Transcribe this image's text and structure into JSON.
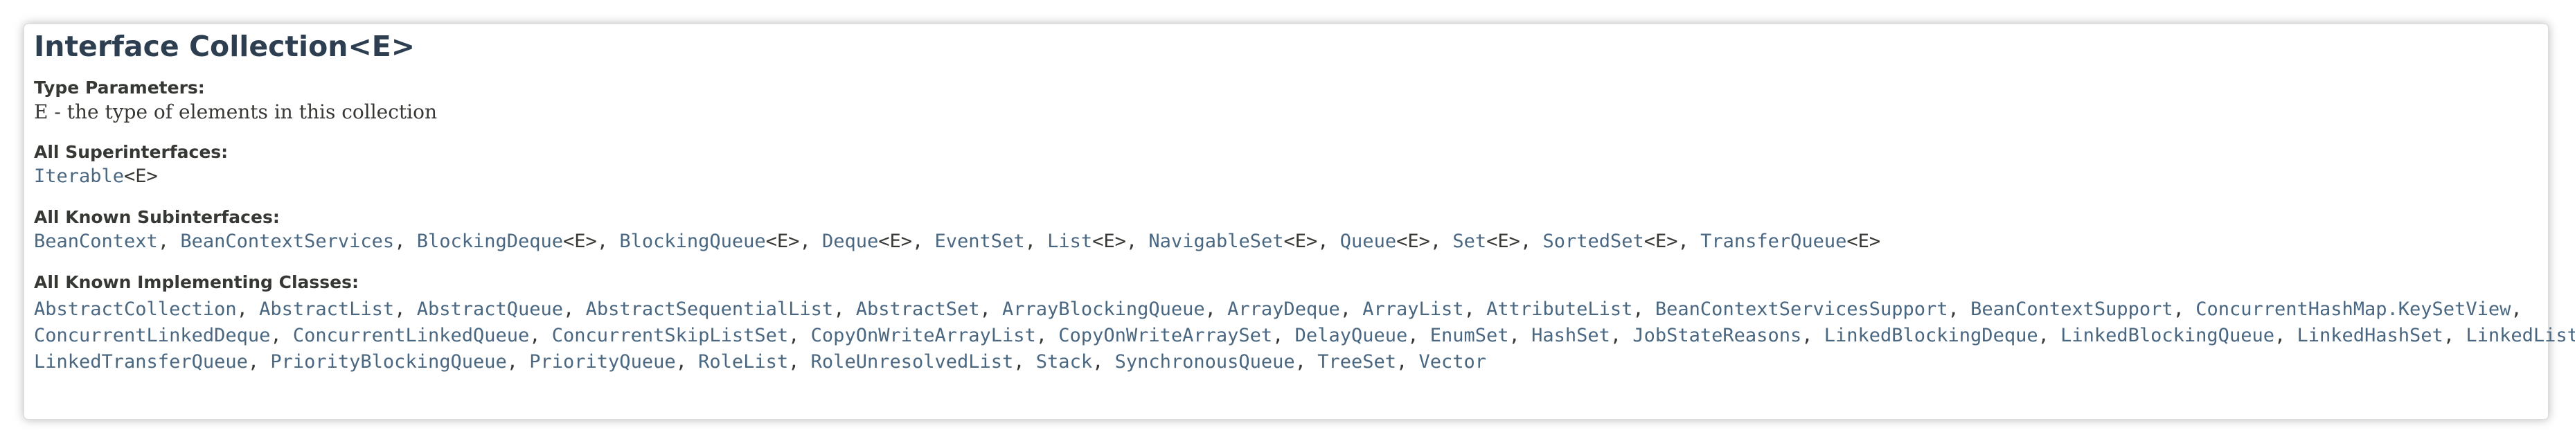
{
  "page": {
    "title": "Interface Collection<E>"
  },
  "type_parameters": {
    "label": "Type Parameters:",
    "text": "E - the type of elements in this collection"
  },
  "superinterfaces": {
    "label": "All Superinterfaces:",
    "items": [
      {
        "name": "Iterable",
        "generic": "<E>"
      }
    ]
  },
  "subinterfaces": {
    "label": "All Known Subinterfaces:",
    "items": [
      {
        "name": "BeanContext",
        "generic": ""
      },
      {
        "name": "BeanContextServices",
        "generic": ""
      },
      {
        "name": "BlockingDeque",
        "generic": "<E>"
      },
      {
        "name": "BlockingQueue",
        "generic": "<E>"
      },
      {
        "name": "Deque",
        "generic": "<E>"
      },
      {
        "name": "EventSet",
        "generic": ""
      },
      {
        "name": "List",
        "generic": "<E>"
      },
      {
        "name": "NavigableSet",
        "generic": "<E>"
      },
      {
        "name": "Queue",
        "generic": "<E>"
      },
      {
        "name": "Set",
        "generic": "<E>"
      },
      {
        "name": "SortedSet",
        "generic": "<E>"
      },
      {
        "name": "TransferQueue",
        "generic": "<E>"
      }
    ]
  },
  "implementing_classes": {
    "label": "All Known Implementing Classes:",
    "lines": [
      [
        "AbstractCollection",
        "AbstractList",
        "AbstractQueue",
        "AbstractSequentialList",
        "AbstractSet",
        "ArrayBlockingQueue",
        "ArrayDeque",
        "ArrayList",
        "AttributeList",
        "BeanContextServicesSupport",
        "BeanContextSupport",
        "ConcurrentHashMap.KeySetView"
      ],
      [
        "ConcurrentLinkedDeque",
        "ConcurrentLinkedQueue",
        "ConcurrentSkipListSet",
        "CopyOnWriteArrayList",
        "CopyOnWriteArraySet",
        "DelayQueue",
        "EnumSet",
        "HashSet",
        "JobStateReasons",
        "LinkedBlockingDeque",
        "LinkedBlockingQueue",
        "LinkedHashSet",
        "LinkedList"
      ],
      [
        "LinkedTransferQueue",
        "PriorityBlockingQueue",
        "PriorityQueue",
        "RoleList",
        "RoleUnresolvedList",
        "Stack",
        "SynchronousQueue",
        "TreeSet",
        "Vector"
      ]
    ]
  }
}
